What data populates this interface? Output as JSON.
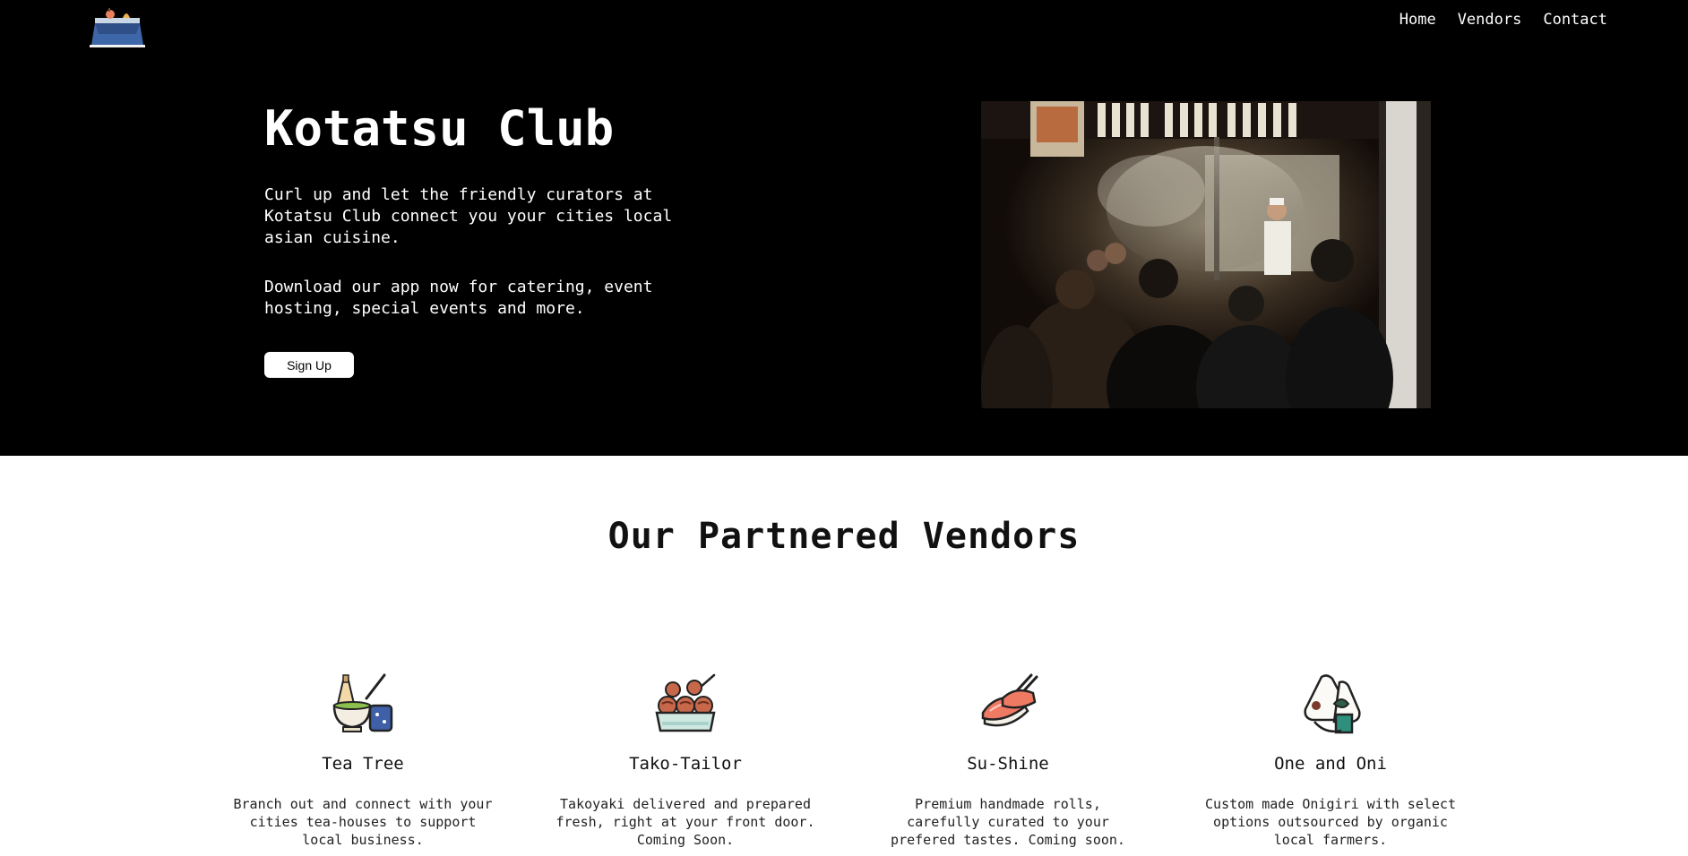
{
  "nav": {
    "items": [
      "Home",
      "Vendors",
      "Contact"
    ]
  },
  "hero": {
    "title": "Kotatsu Club",
    "para1": "Curl up and let the friendly curators at Kotatsu Club connect you your cities local asian cuisine.",
    "para2": "Download our app now for catering, event hosting, special events and more.",
    "signup_label": "Sign Up"
  },
  "vendors": {
    "title": "Our Partnered Vendors",
    "items": [
      {
        "name": "Tea Tree",
        "desc": "Branch out and connect with your cities tea-houses to support local business.",
        "icon": "matcha-tea-icon"
      },
      {
        "name": "Tako-Tailor",
        "desc": "Takoyaki delivered and prepared fresh, right at your front door. Coming Soon.",
        "icon": "takoyaki-icon"
      },
      {
        "name": "Su-Shine",
        "desc": "Premium handmade rolls, carefully curated to your prefered tastes. Coming soon.",
        "icon": "sushi-icon"
      },
      {
        "name": "One and Oni",
        "desc": "Custom made Onigiri with select options outsourced by organic local farmers.",
        "icon": "onigiri-icon"
      }
    ]
  },
  "colors": {
    "hero_bg": "#000000",
    "page_bg": "#ffffff",
    "text_dark": "#111111"
  }
}
